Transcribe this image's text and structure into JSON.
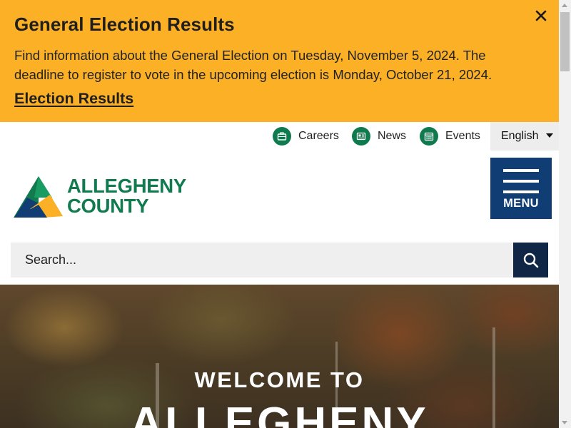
{
  "alert": {
    "title": "General Election Results",
    "body": "Find information about the General Election on Tuesday, November 5, 2024. The deadline to register to vote in the upcoming election is Monday, October 21, 2024.",
    "link_label": "Election Results",
    "close_icon": "close-icon"
  },
  "utility_nav": {
    "items": [
      {
        "label": "Careers",
        "icon": "briefcase-icon"
      },
      {
        "label": "News",
        "icon": "newspaper-icon"
      },
      {
        "label": "Events",
        "icon": "calendar-icon"
      }
    ],
    "language": {
      "selected": "English"
    }
  },
  "logo": {
    "line1": "ALLEGHENY",
    "line2": "COUNTY"
  },
  "menu": {
    "label": "MENU"
  },
  "search": {
    "placeholder": "Search..."
  },
  "hero": {
    "kicker": "WELCOME TO",
    "title": "ALLEGHENY"
  },
  "colors": {
    "alert_bg": "#fbb025",
    "brand_green": "#117a4e",
    "navy": "#0f3d74",
    "search_button": "#0f2646"
  }
}
